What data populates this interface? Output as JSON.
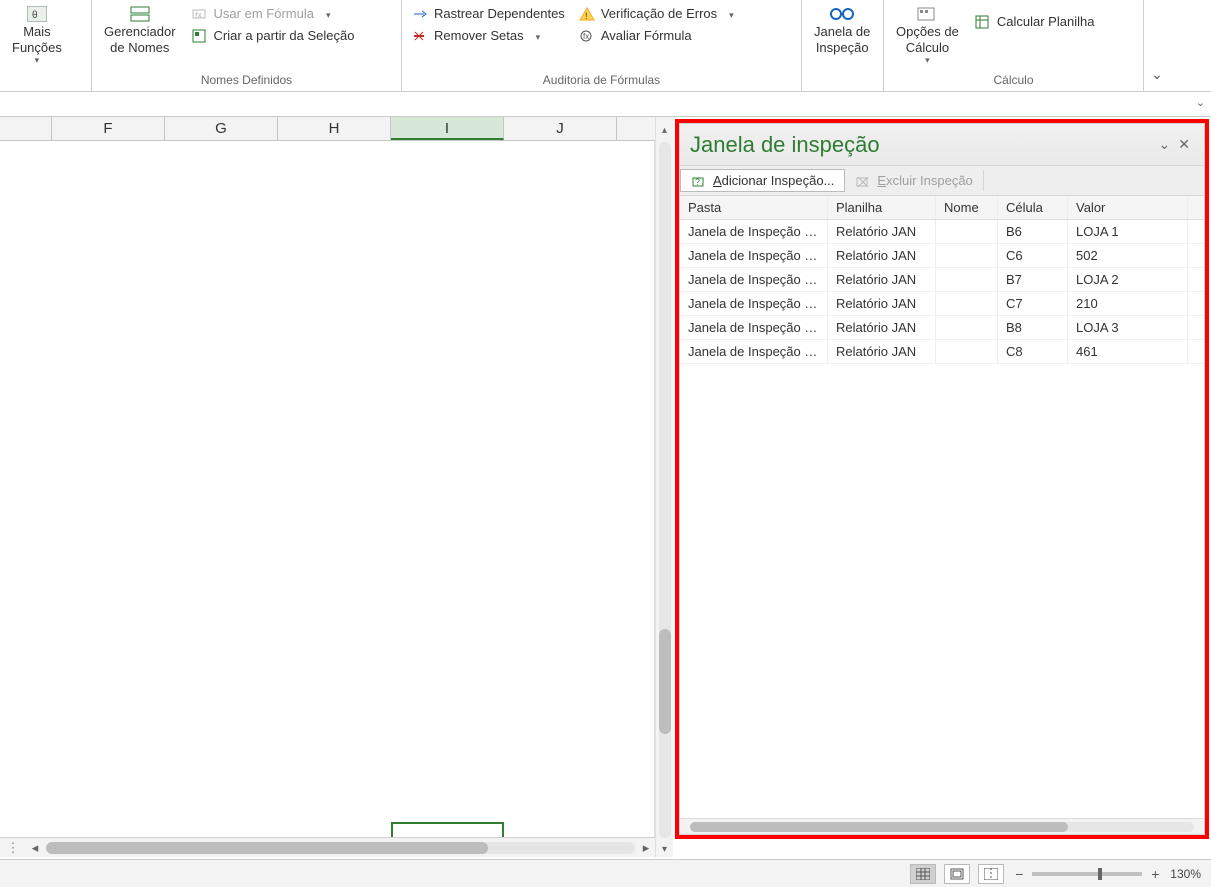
{
  "ribbon": {
    "mais_funcoes": "Mais\nFunções",
    "gerenciador_nomes": "Gerenciador\nde Nomes",
    "usar_formula": "Usar em Fórmula",
    "criar_selecao": "Criar a partir da Seleção",
    "group_nomes": "Nomes Definidos",
    "rastrear_dependentes": "Rastrear Dependentes",
    "remover_setas": "Remover Setas",
    "verificacao_erros": "Verificação de Erros",
    "avaliar_formula": "Avaliar Fórmula",
    "group_auditoria": "Auditoria de Fórmulas",
    "janela_inspecao": "Janela de\nInspeção",
    "opcoes_calculo": "Opções de\nCálculo",
    "calcular_planilha": "Calcular Planilha",
    "group_calculo": "Cálculo"
  },
  "columns": [
    "F",
    "G",
    "H",
    "I",
    "J"
  ],
  "active_col_index": 3,
  "panel": {
    "title": "Janela de inspeção",
    "add_label": "Adicionar Inspeção...",
    "del_label": "Excluir Inspeção",
    "headers": {
      "pasta": "Pasta",
      "plan": "Planilha",
      "nome": "Nome",
      "cel": "Célula",
      "val": "Valor"
    },
    "rows": [
      {
        "pasta": "Janela de Inspeção (IN...",
        "plan": "Relatório JAN",
        "nome": "",
        "cel": "B6",
        "val": "LOJA 1"
      },
      {
        "pasta": "Janela de Inspeção (IN...",
        "plan": "Relatório JAN",
        "nome": "",
        "cel": "C6",
        "val": "502"
      },
      {
        "pasta": "Janela de Inspeção (IN...",
        "plan": "Relatório JAN",
        "nome": "",
        "cel": "B7",
        "val": "LOJA 2"
      },
      {
        "pasta": "Janela de Inspeção (IN...",
        "plan": "Relatório JAN",
        "nome": "",
        "cel": "C7",
        "val": "210"
      },
      {
        "pasta": "Janela de Inspeção (IN...",
        "plan": "Relatório JAN",
        "nome": "",
        "cel": "B8",
        "val": "LOJA 3"
      },
      {
        "pasta": "Janela de Inspeção (IN...",
        "plan": "Relatório JAN",
        "nome": "",
        "cel": "C8",
        "val": "461"
      }
    ]
  },
  "status": {
    "zoom": "130%"
  }
}
